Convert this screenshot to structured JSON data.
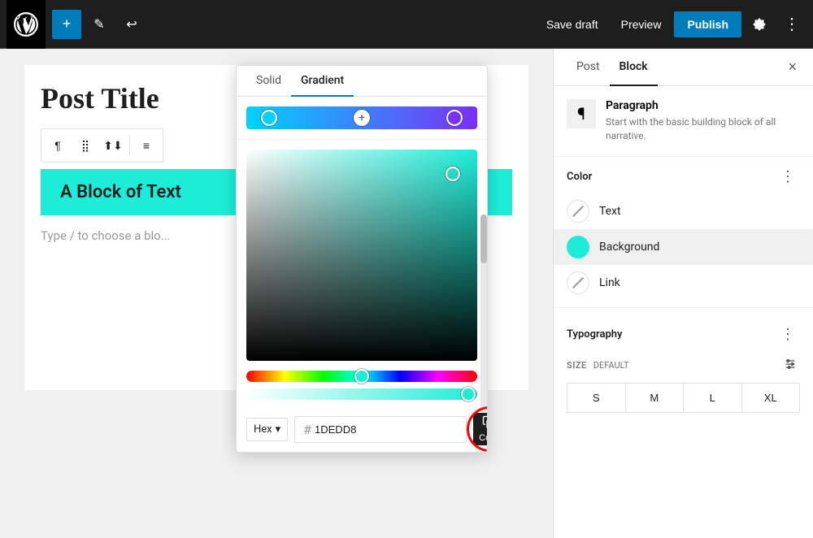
{
  "toolbar": {
    "add_icon": "+",
    "edit_icon": "✎",
    "undo_icon": "↩",
    "save_draft_label": "Save draft",
    "preview_label": "Preview",
    "publish_label": "Publish",
    "more_icon": "⋮"
  },
  "editor": {
    "post_title": "Post Title",
    "block_text": "A Block of Text",
    "placeholder": "Type / to choose a blo..."
  },
  "color_picker": {
    "tab_solid": "Solid",
    "tab_gradient": "Gradient",
    "hex_label": "Hex",
    "hex_dropdown_icon": "▾",
    "hex_value": "1DEDD8",
    "hex_prefix": "#",
    "copy_label": "Copy"
  },
  "sidebar": {
    "tab_post": "Post",
    "tab_block": "Block",
    "close_icon": "×",
    "block_title": "Paragraph",
    "block_description": "Start with the basic building block of all narrative.",
    "color_section_title": "Color",
    "color_more_icon": "⋮",
    "color_options": [
      {
        "label": "Text",
        "type": "slash"
      },
      {
        "label": "Background",
        "type": "teal"
      },
      {
        "label": "Link",
        "type": "slash"
      }
    ],
    "typography_section_title": "Typography",
    "typography_more_icon": "⋮",
    "size_label": "SIZE",
    "size_default": "DEFAULT",
    "size_buttons": [
      "S",
      "M",
      "L",
      "XL"
    ]
  }
}
